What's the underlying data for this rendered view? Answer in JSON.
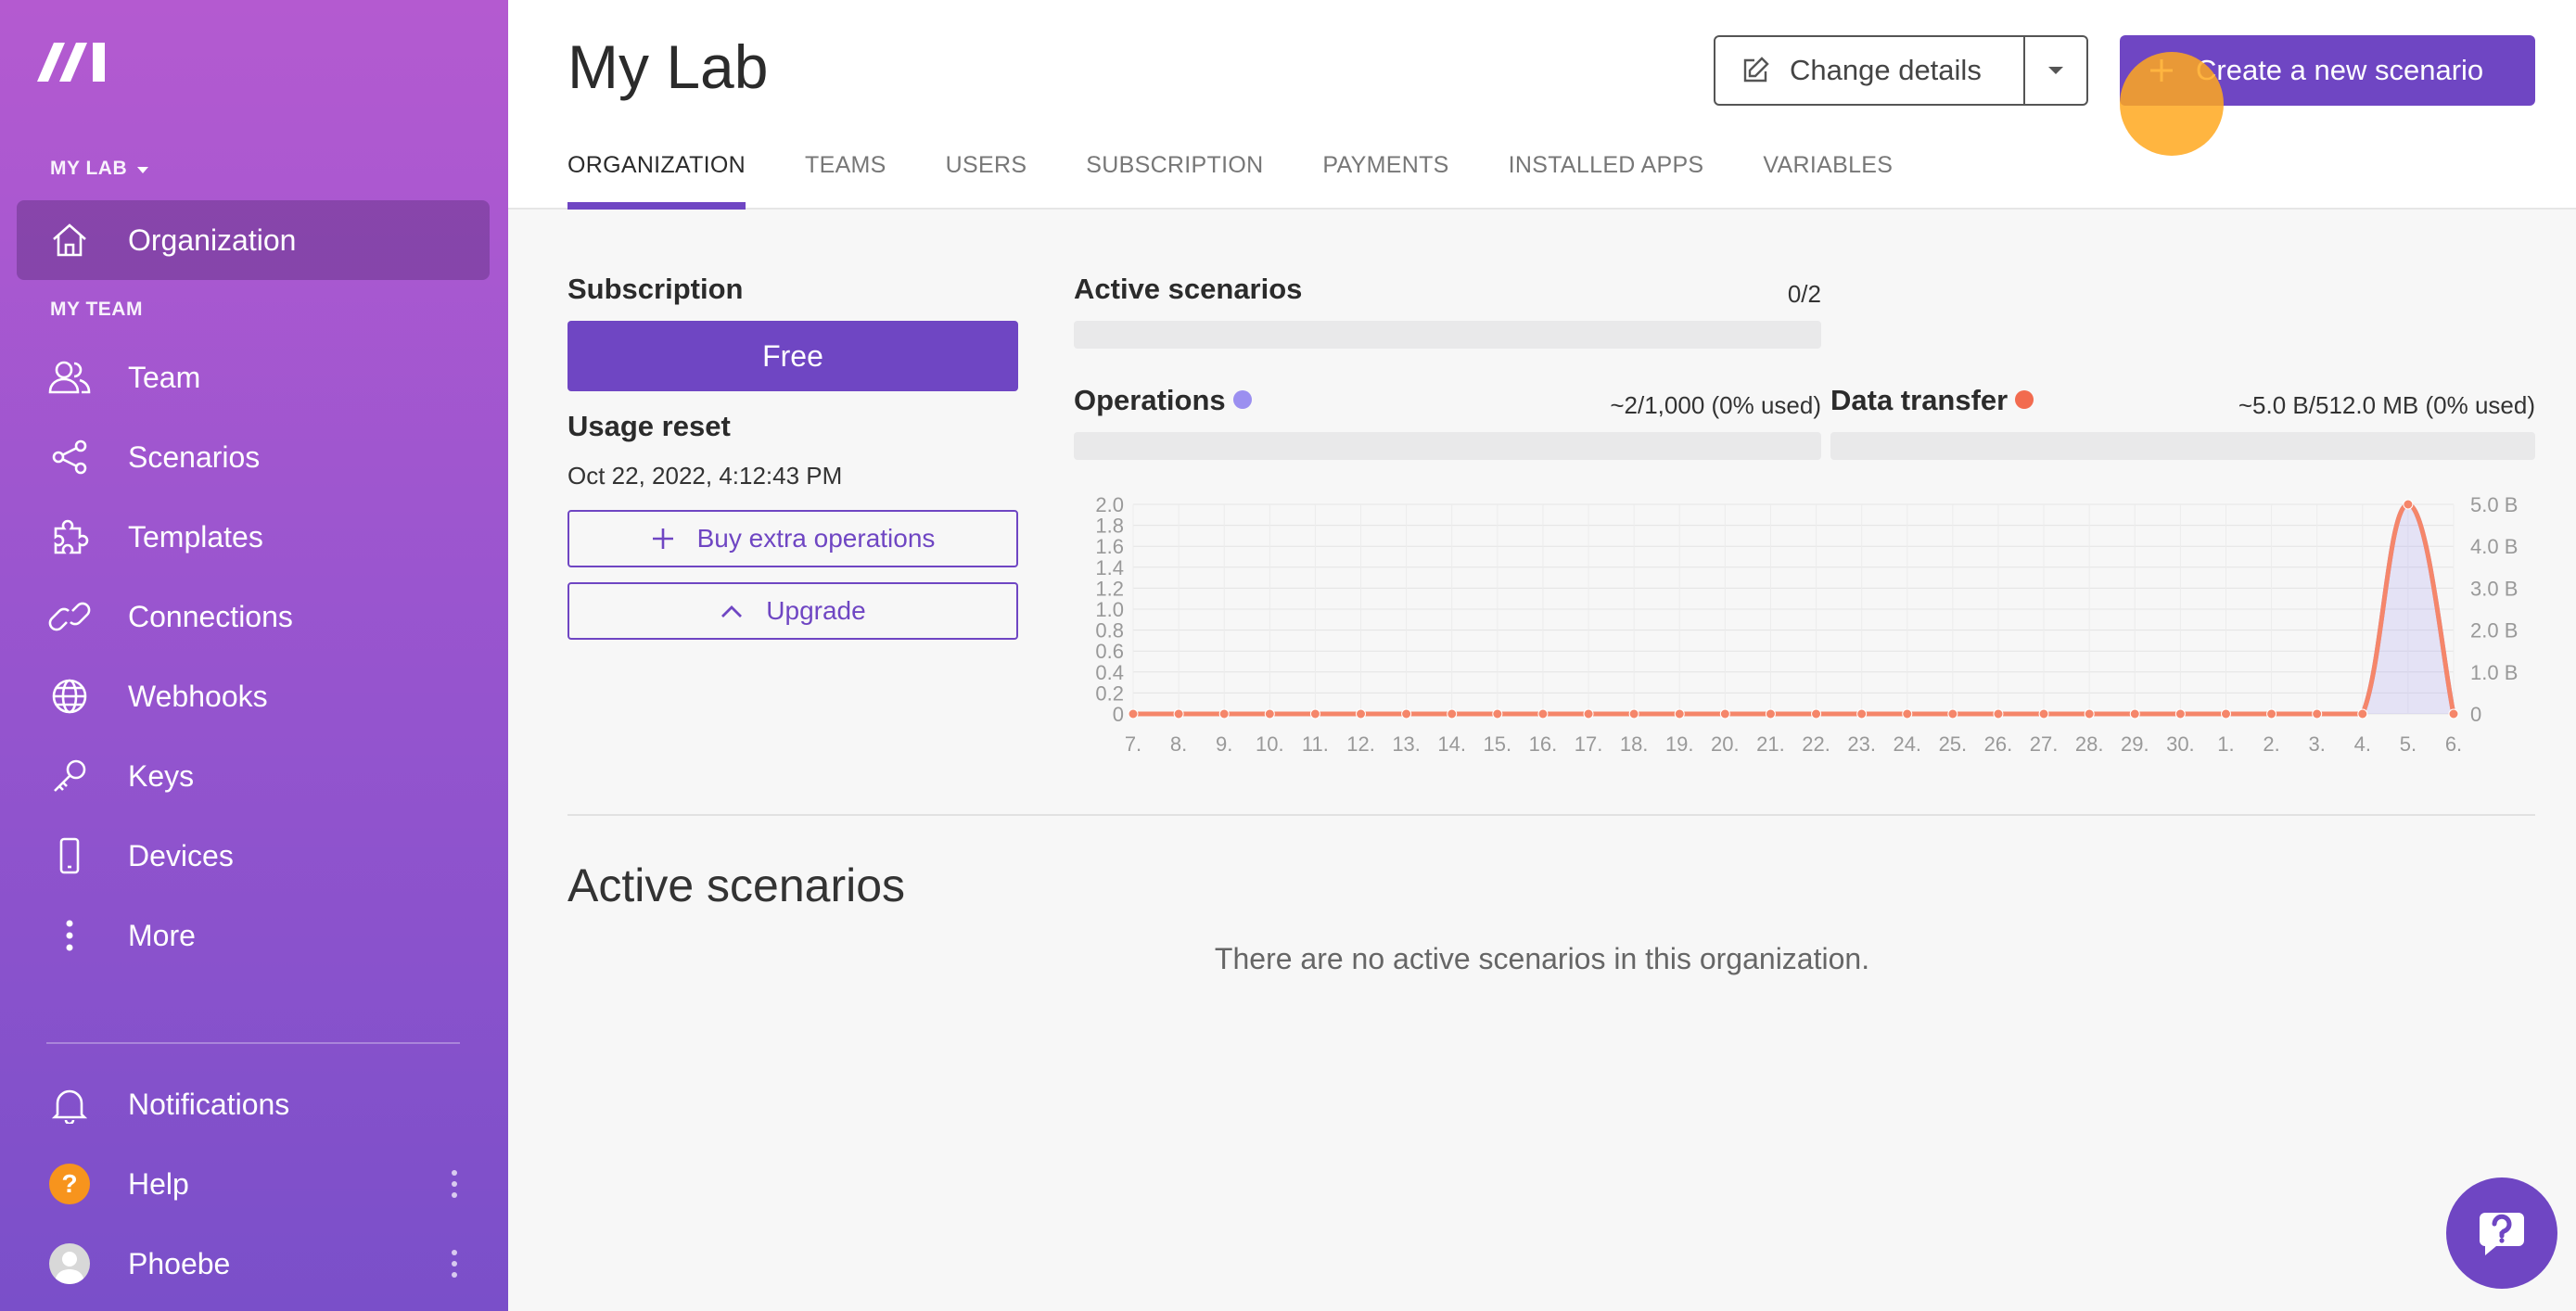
{
  "sidebar": {
    "org_label": "MY LAB",
    "org_item": {
      "label": "Organization",
      "icon": "home-icon"
    },
    "team_label": "MY TEAM",
    "items": [
      {
        "label": "Team",
        "icon": "users-icon"
      },
      {
        "label": "Scenarios",
        "icon": "share-nodes-icon"
      },
      {
        "label": "Templates",
        "icon": "puzzle-icon"
      },
      {
        "label": "Connections",
        "icon": "link-icon"
      },
      {
        "label": "Webhooks",
        "icon": "globe-icon"
      },
      {
        "label": "Keys",
        "icon": "key-icon"
      },
      {
        "label": "Devices",
        "icon": "phone-icon"
      },
      {
        "label": "More",
        "icon": "vertical-dots-icon"
      }
    ],
    "bottom": {
      "notifications": "Notifications",
      "help": "Help",
      "help_badge": "?",
      "user": "Phoebe"
    }
  },
  "header": {
    "title": "My Lab",
    "change_details": "Change details",
    "create_scenario": "Create a new scenario",
    "tabs": [
      "ORGANIZATION",
      "TEAMS",
      "USERS",
      "SUBSCRIPTION",
      "PAYMENTS",
      "INSTALLED APPS",
      "VARIABLES"
    ],
    "active_tab": "ORGANIZATION"
  },
  "subscription": {
    "label": "Subscription",
    "plan": "Free",
    "usage_reset_label": "Usage reset",
    "usage_reset_date": "Oct 22, 2022, 4:12:43 PM",
    "buy_ops": "Buy extra operations",
    "upgrade": "Upgrade"
  },
  "stats": {
    "active_scenarios": {
      "label": "Active scenarios",
      "value": "0/2",
      "fraction": 0
    },
    "operations": {
      "label": "Operations",
      "value": "~2/1,000 (0% used)",
      "fraction": 0,
      "dot_color": "#9b8ff0"
    },
    "data_transfer": {
      "label": "Data transfer",
      "value": "~5.0 B/512.0 MB (0% used)",
      "fraction": 0,
      "dot_color": "#f26b4f"
    }
  },
  "chart_data": {
    "type": "area",
    "categories": [
      "7.",
      "8.",
      "9.",
      "10.",
      "11.",
      "12.",
      "13.",
      "14.",
      "15.",
      "16.",
      "17.",
      "18.",
      "19.",
      "20.",
      "21.",
      "22.",
      "23.",
      "24.",
      "25.",
      "26.",
      "27.",
      "28.",
      "29.",
      "30.",
      "1.",
      "2.",
      "3.",
      "4.",
      "5.",
      "6."
    ],
    "y_left": {
      "ticks": [
        "0",
        "0.2",
        "0.4",
        "0.6",
        "0.8",
        "1.0",
        "1.2",
        "1.4",
        "1.6",
        "1.8",
        "2.0"
      ],
      "ylim": [
        0,
        2
      ]
    },
    "y_right": {
      "ticks": [
        "0",
        "1.0 B",
        "2.0 B",
        "3.0 B",
        "4.0 B",
        "5.0 B"
      ],
      "ylim": [
        0,
        5
      ]
    },
    "series": [
      {
        "name": "Operations",
        "axis": "left",
        "color": "#9b8ff0",
        "fill": "rgba(155,143,240,0.2)",
        "values": [
          0,
          0,
          0,
          0,
          0,
          0,
          0,
          0,
          0,
          0,
          0,
          0,
          0,
          0,
          0,
          0,
          0,
          0,
          0,
          0,
          0,
          0,
          0,
          0,
          0,
          0,
          0,
          0,
          2,
          0
        ]
      },
      {
        "name": "Data transfer",
        "axis": "right",
        "color": "#f5866a",
        "values": [
          0,
          0,
          0,
          0,
          0,
          0,
          0,
          0,
          0,
          0,
          0,
          0,
          0,
          0,
          0,
          0,
          0,
          0,
          0,
          0,
          0,
          0,
          0,
          0,
          0,
          0,
          0,
          0,
          5,
          0
        ]
      }
    ],
    "grid": true
  },
  "active_section": {
    "title": "Active scenarios",
    "empty_message": "There are no active scenarios in this organization."
  },
  "colors": {
    "accent": "#6f46c3",
    "cursor_highlight": "#ffa81e"
  }
}
